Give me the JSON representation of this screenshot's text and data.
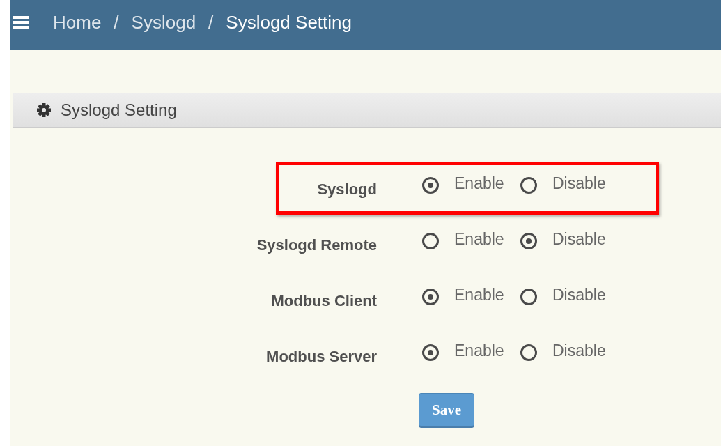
{
  "breadcrumb": [
    {
      "label": "Home",
      "current": false
    },
    {
      "label": "Syslogd",
      "current": false
    },
    {
      "label": "Syslogd Setting",
      "current": true
    }
  ],
  "breadcrumb_separator": "/",
  "panel": {
    "title": "Syslogd Setting"
  },
  "settings": [
    {
      "label": "Syslogd",
      "highlighted": true,
      "options": [
        {
          "label": "Enable",
          "selected": true
        },
        {
          "label": "Disable",
          "selected": false
        }
      ]
    },
    {
      "label": "Syslogd Remote",
      "highlighted": false,
      "options": [
        {
          "label": "Enable",
          "selected": false
        },
        {
          "label": "Disable",
          "selected": true
        }
      ]
    },
    {
      "label": "Modbus Client",
      "highlighted": false,
      "options": [
        {
          "label": "Enable",
          "selected": true
        },
        {
          "label": "Disable",
          "selected": false
        }
      ]
    },
    {
      "label": "Modbus Server",
      "highlighted": false,
      "options": [
        {
          "label": "Enable",
          "selected": true
        },
        {
          "label": "Disable",
          "selected": false
        }
      ]
    }
  ],
  "save_button": "Save"
}
